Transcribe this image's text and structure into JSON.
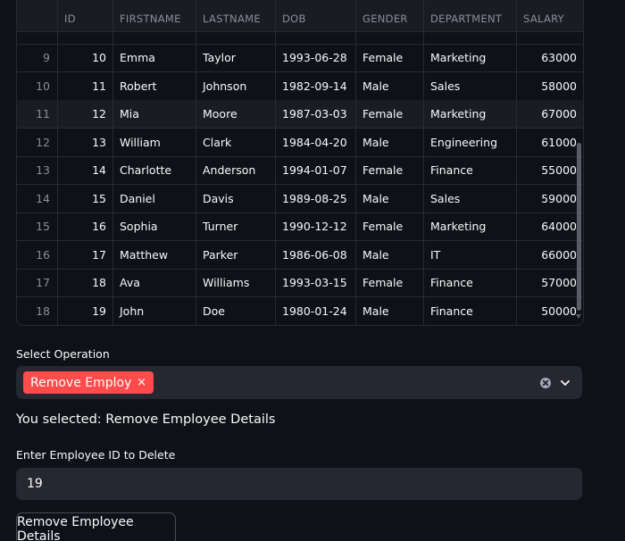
{
  "table": {
    "columns": [
      "",
      "ID",
      "FIRSTNAME",
      "LASTNAME",
      "DOB",
      "GENDER",
      "DEPARTMENT",
      "SALARY"
    ],
    "rows": [
      {
        "index": "9",
        "id": "10",
        "firstname": "Emma",
        "lastname": "Taylor",
        "dob": "1993-06-28",
        "gender": "Female",
        "department": "Marketing",
        "salary": "63000"
      },
      {
        "index": "10",
        "id": "11",
        "firstname": "Robert",
        "lastname": "Johnson",
        "dob": "1982-09-14",
        "gender": "Male",
        "department": "Sales",
        "salary": "58000"
      },
      {
        "index": "11",
        "id": "12",
        "firstname": "Mia",
        "lastname": "Moore",
        "dob": "1987-03-03",
        "gender": "Female",
        "department": "Marketing",
        "salary": "67000"
      },
      {
        "index": "12",
        "id": "13",
        "firstname": "William",
        "lastname": "Clark",
        "dob": "1984-04-20",
        "gender": "Male",
        "department": "Engineering",
        "salary": "61000"
      },
      {
        "index": "13",
        "id": "14",
        "firstname": "Charlotte",
        "lastname": "Anderson",
        "dob": "1994-01-07",
        "gender": "Female",
        "department": "Finance",
        "salary": "55000"
      },
      {
        "index": "14",
        "id": "15",
        "firstname": "Daniel",
        "lastname": "Davis",
        "dob": "1989-08-25",
        "gender": "Male",
        "department": "Sales",
        "salary": "59000"
      },
      {
        "index": "15",
        "id": "16",
        "firstname": "Sophia",
        "lastname": "Turner",
        "dob": "1990-12-12",
        "gender": "Female",
        "department": "Marketing",
        "salary": "64000"
      },
      {
        "index": "16",
        "id": "17",
        "firstname": "Matthew",
        "lastname": "Parker",
        "dob": "1986-06-08",
        "gender": "Male",
        "department": "IT",
        "salary": "66000"
      },
      {
        "index": "17",
        "id": "18",
        "firstname": "Ava",
        "lastname": "Williams",
        "dob": "1993-03-15",
        "gender": "Female",
        "department": "Finance",
        "salary": "57000"
      },
      {
        "index": "18",
        "id": "19",
        "firstname": "John",
        "lastname": "Doe",
        "dob": "1980-01-24",
        "gender": "Male",
        "department": "Finance",
        "salary": "50000"
      }
    ]
  },
  "operation": {
    "label": "Select Operation",
    "selected_tag": "Remove Employ…",
    "tag_remove": "×"
  },
  "selected_message": "You selected: Remove Employee Details",
  "employee_id_input": {
    "label": "Enter Employee ID to Delete",
    "value": "19"
  },
  "submit_button": {
    "label": "Remove Employee Details"
  },
  "colors": {
    "background": "#0e1117",
    "input_bg": "#262730",
    "tag_bg": "#ff4b4b",
    "grid_line": "#262a33"
  }
}
